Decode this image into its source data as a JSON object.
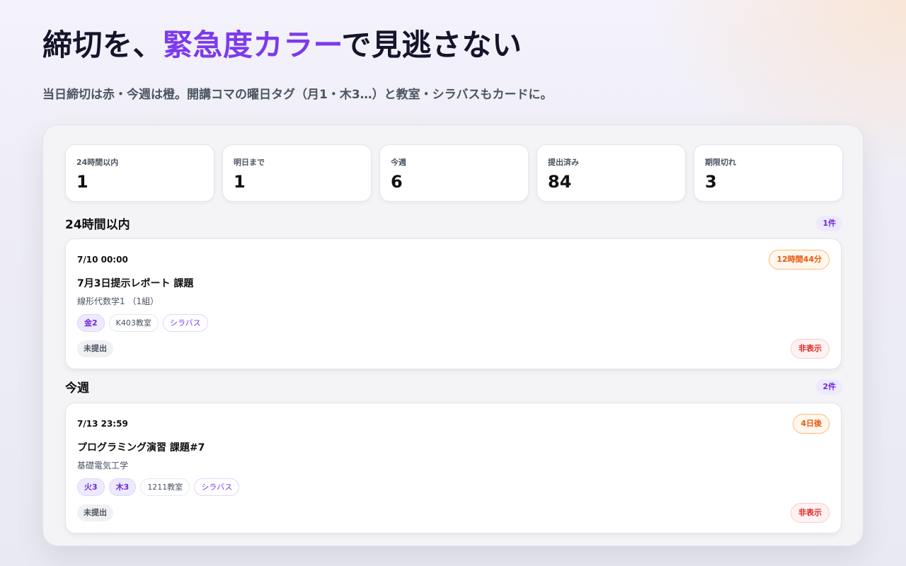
{
  "hero": {
    "title_pre": "締切を、",
    "title_accent": "緊急度カラー",
    "title_post": "で見逃さない",
    "subtitle": "当日締切は赤・今週は橙。開講コマの曜日タグ（月1・木3…）と教室・シラバスもカードに。"
  },
  "stats": [
    {
      "label": "24時間以内",
      "value": "1"
    },
    {
      "label": "明日まで",
      "value": "1"
    },
    {
      "label": "今週",
      "value": "6"
    },
    {
      "label": "提出済み",
      "value": "84"
    },
    {
      "label": "期限切れ",
      "value": "3"
    }
  ],
  "sections": [
    {
      "title": "24時間以内",
      "count": "1件",
      "card": {
        "due": "7/10 00:00",
        "remaining": "12時間44分",
        "title": "7月3日提示レポート 課題",
        "course": "線形代数学1 （1組）",
        "day_tags": [
          "金2"
        ],
        "room": "K403教室",
        "syllabus": "シラバス",
        "status": "未提出",
        "hide_label": "非表示"
      }
    },
    {
      "title": "今週",
      "count": "2件",
      "card": {
        "due": "7/13 23:59",
        "remaining": "4日後",
        "title": "プログラミング演習 課題#7",
        "course": "基礎電気工学",
        "day_tags": [
          "火3",
          "木3"
        ],
        "room": "1211教室",
        "syllabus": "シラバス",
        "status": "未提出",
        "hide_label": "非表示"
      }
    }
  ],
  "colors": {
    "accent": "#7c3aed",
    "warning": "#ea580c",
    "danger": "#dc2626"
  }
}
